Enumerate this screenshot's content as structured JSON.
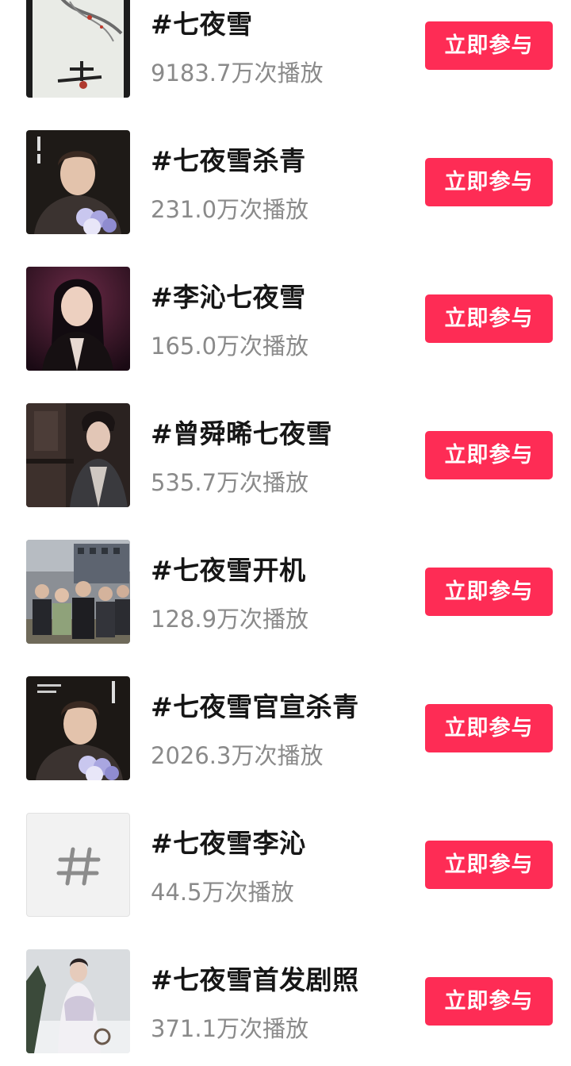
{
  "topics": [
    {
      "title": "#七夜雪",
      "plays": "9183.7万次播放",
      "button": "立即参与",
      "thumb": "poster-calligraphy"
    },
    {
      "title": "#七夜雪杀青",
      "plays": "231.0万次播放",
      "button": "立即参与",
      "thumb": "actor-with-flowers"
    },
    {
      "title": "#李沁七夜雪",
      "plays": "165.0万次播放",
      "button": "立即参与",
      "thumb": "actress-portrait"
    },
    {
      "title": "#曾舜晞七夜雪",
      "plays": "535.7万次播放",
      "button": "立即参与",
      "thumb": "actor-costume"
    },
    {
      "title": "#七夜雪开机",
      "plays": "128.9万次播放",
      "button": "立即参与",
      "thumb": "crowd-outdoor"
    },
    {
      "title": "#七夜雪官宣杀青",
      "plays": "2026.3万次播放",
      "button": "立即参与",
      "thumb": "actor-with-flowers-poster"
    },
    {
      "title": "#七夜雪李沁",
      "plays": "44.5万次播放",
      "button": "立即参与",
      "thumb": "hashtag-placeholder"
    },
    {
      "title": "#七夜雪首发剧照",
      "plays": "371.1万次播放",
      "button": "立即参与",
      "thumb": "woman-in-snow"
    }
  ]
}
